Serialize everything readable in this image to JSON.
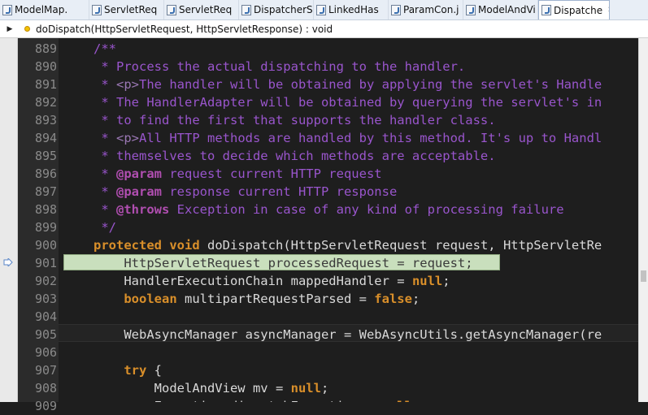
{
  "tabs": [
    {
      "label": "ModelMap."
    },
    {
      "label": "ServletReq"
    },
    {
      "label": "ServletReq"
    },
    {
      "label": "DispatcherS"
    },
    {
      "label": "LinkedHas"
    },
    {
      "label": "ParamCon.j"
    },
    {
      "label": "ModelAndVi"
    },
    {
      "label": "Dispatche",
      "active": true,
      "close": "✕"
    }
  ],
  "breadcrumb": {
    "arrow": "▶",
    "method": "doDispatch(HttpServletRequest, HttpServletResponse) : void"
  },
  "editor": {
    "lines": [
      {
        "n": "889",
        "parts": [
          [
            "cm",
            "/**"
          ]
        ]
      },
      {
        "n": "890",
        "parts": [
          [
            "cm",
            " * Process the actual dispatching to the handler."
          ]
        ]
      },
      {
        "n": "891",
        "parts": [
          [
            "cm",
            " * "
          ],
          [
            "tag",
            "<p>"
          ],
          [
            "cm",
            "The handler will be obtained by applying the servlet's Handle"
          ]
        ]
      },
      {
        "n": "892",
        "parts": [
          [
            "cm",
            " * The HandlerAdapter will be obtained by querying the servlet's in"
          ]
        ]
      },
      {
        "n": "893",
        "parts": [
          [
            "cm",
            " * to find the first that supports the handler class."
          ]
        ]
      },
      {
        "n": "894",
        "parts": [
          [
            "cm",
            " * "
          ],
          [
            "tag",
            "<p>"
          ],
          [
            "cm",
            "All HTTP methods are handled by this method. It's up to Handl"
          ]
        ]
      },
      {
        "n": "895",
        "parts": [
          [
            "cm",
            " * themselves to decide which methods are acceptable."
          ]
        ]
      },
      {
        "n": "896",
        "parts": [
          [
            "cm",
            " * "
          ],
          [
            "ann",
            "@param"
          ],
          [
            "cm",
            " request current HTTP request"
          ]
        ]
      },
      {
        "n": "897",
        "parts": [
          [
            "cm",
            " * "
          ],
          [
            "ann",
            "@param"
          ],
          [
            "cm",
            " response current HTTP response"
          ]
        ]
      },
      {
        "n": "898",
        "parts": [
          [
            "cm",
            " * "
          ],
          [
            "ann",
            "@throws"
          ],
          [
            "cm",
            " Exception in case of any kind of processing failure"
          ]
        ]
      },
      {
        "n": "899",
        "parts": [
          [
            "cm",
            " */"
          ]
        ]
      },
      {
        "n": "900",
        "parts": [
          [
            "kw",
            "protected"
          ],
          [
            "fld",
            " "
          ],
          [
            "kw",
            "void"
          ],
          [
            "fld",
            " doDispatch(HttpServletRequest request, HttpServletRe"
          ]
        ]
      },
      {
        "n": "901",
        "parts": [
          [
            "dim",
            "    HttpServletRequest processedRequest = request;"
          ]
        ]
      },
      {
        "n": "902",
        "parts": [
          [
            "fld",
            "    HandlerExecutionChain mappedHandler = "
          ],
          [
            "kw",
            "null"
          ],
          [
            "fld",
            ";"
          ]
        ]
      },
      {
        "n": "903",
        "parts": [
          [
            "fld",
            "    "
          ],
          [
            "kw",
            "boolean"
          ],
          [
            "fld",
            " multipartRequestParsed = "
          ],
          [
            "kw",
            "false"
          ],
          [
            "fld",
            ";"
          ]
        ]
      },
      {
        "n": "904",
        "parts": [
          [
            "fld",
            ""
          ]
        ]
      },
      {
        "n": "905",
        "parts": [
          [
            "fld",
            "    WebAsyncManager asyncManager = WebAsyncUtils.getAsyncManager(re"
          ]
        ]
      },
      {
        "n": "906",
        "parts": [
          [
            "fld",
            ""
          ]
        ]
      },
      {
        "n": "907",
        "parts": [
          [
            "fld",
            "    "
          ],
          [
            "kw",
            "try"
          ],
          [
            "fld",
            " {"
          ]
        ]
      },
      {
        "n": "908",
        "parts": [
          [
            "fld",
            "        ModelAndView mv = "
          ],
          [
            "kw",
            "null"
          ],
          [
            "fld",
            ";"
          ]
        ]
      },
      {
        "n": "909",
        "parts": [
          [
            "fld",
            "        Exception dispatchException = "
          ],
          [
            "kw",
            "null"
          ],
          [
            "fld",
            ";"
          ]
        ]
      }
    ]
  }
}
